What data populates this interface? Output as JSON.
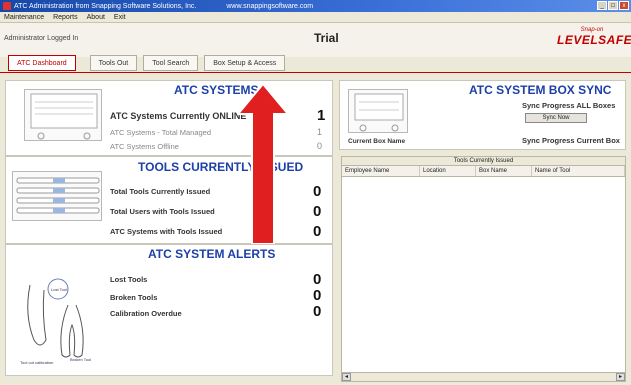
{
  "window": {
    "title": "ATC Administration from Snapping Software Solutions, Inc.",
    "url": "www.snappingsoftware.com"
  },
  "menu": [
    "Maintenance",
    "Reports",
    "About",
    "Exit"
  ],
  "header": {
    "admin_label": "Administrator Logged In",
    "trial": "Trial",
    "brand_top": "Snap-on",
    "brand_main": "LEVELSAFE"
  },
  "tabs": [
    "ATC Dashboard",
    "Tools Out",
    "Tool Search",
    "Box Setup & Access"
  ],
  "systems": {
    "title": "ATC SYSTEMS",
    "rows": [
      {
        "label": "ATC Systems Currently ONLINE",
        "value": "1"
      },
      {
        "label": "ATC Systems - Total Managed",
        "value": "1"
      },
      {
        "label": "ATC Systems Offline",
        "value": "0"
      }
    ]
  },
  "tools": {
    "title": "TOOLS CURRENTLY ISSUED",
    "rows": [
      {
        "label": "Total Tools Currently Issued",
        "value": "0"
      },
      {
        "label": "Total Users with Tools Issued",
        "value": "0"
      },
      {
        "label": "ATC Systems with Tools Issued",
        "value": "0"
      }
    ]
  },
  "alerts": {
    "title": "ATC SYSTEM ALERTS",
    "rows": [
      {
        "label": "Lost Tools",
        "value": "0"
      },
      {
        "label": "Broken Tools",
        "value": "0"
      },
      {
        "label": "Calibration Overdue",
        "value": "0"
      }
    ],
    "image_captions": [
      "Lost Tool",
      "Broken Tool",
      "Tool out calibration"
    ]
  },
  "sync": {
    "title": "ATC SYSTEM BOX SYNC",
    "progress_all": "Sync Progress ALL Boxes",
    "sync_button": "Sync Now",
    "current_box_label": "Current Box Name",
    "progress_current": "Sync Progress Current Box"
  },
  "grid": {
    "caption": "Tools Currently Issued",
    "columns": [
      "Employee Name",
      "Location",
      "Box Name",
      "Name of Tool"
    ]
  },
  "colors": {
    "accent": "#c00000",
    "title_blue": "#1c3fa8",
    "arrow": "#e02020"
  }
}
